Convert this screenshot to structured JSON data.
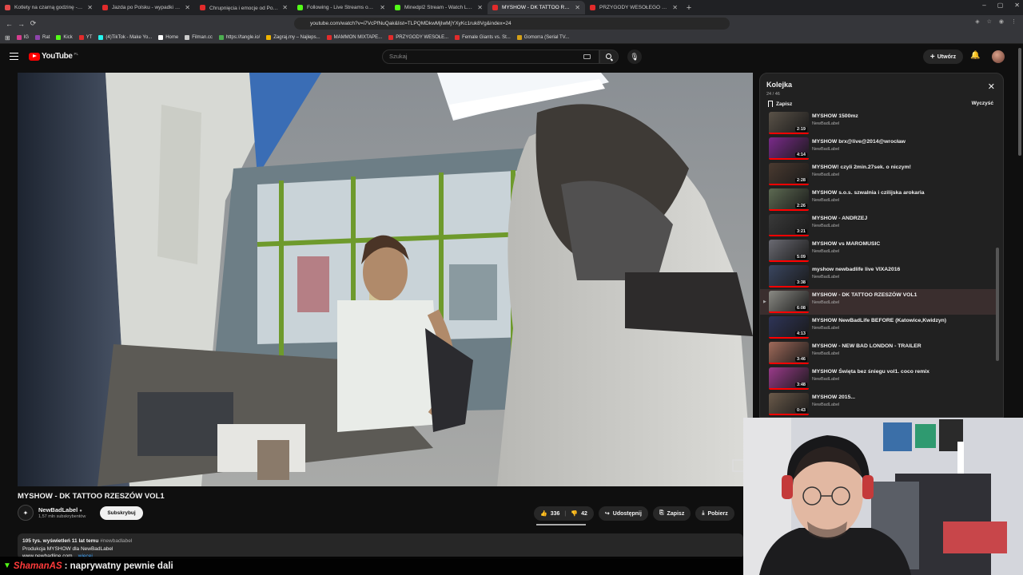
{
  "browser": {
    "tabs": [
      {
        "label": "Kotlety na czarną godzinę - mogą st",
        "fav": "#e24a4a"
      },
      {
        "label": "Jazda po Polsku - wypadki i kolizje o",
        "fav": "#e22b2b"
      },
      {
        "label": "Chrupnięcia i emocje od Poliny 😊",
        "fav": "#e22b2b"
      },
      {
        "label": "Following - Live Streams on Kick",
        "fav": "#53fc18"
      },
      {
        "label": "Minedpl2 Stream - Watch Live on Ki",
        "fav": "#53fc18"
      },
      {
        "label": "MYSHOW - DK TATTOO RZES",
        "fav": "#e22b2b",
        "active": true
      },
      {
        "label": "PRZYGODY WESOŁEGO MAZURA w",
        "fav": "#e22b2b"
      }
    ],
    "url": "youtube.com/watch?v=i7VcPfNuQak&list=TLPQMDkwMjIwMjYXyKc1ruk8Vg&index=24",
    "bookmarks": [
      {
        "label": "IG",
        "color": "#d63e8f"
      },
      {
        "label": "Rat",
        "color": "#8e44ad"
      },
      {
        "label": "Kick",
        "color": "#53fc18"
      },
      {
        "label": "YT",
        "color": "#e22b2b"
      },
      {
        "label": "(4)TikTok - Make Yo...",
        "color": "#25f4ee"
      },
      {
        "label": "Home",
        "color": "#ffffff"
      },
      {
        "label": "Filman.cc",
        "color": "#cccccc"
      },
      {
        "label": "https://tangle.io/",
        "color": "#4caf50"
      },
      {
        "label": "Zagraj.my – Najleps...",
        "color": "#f0b400"
      },
      {
        "label": "MAMMON MIXTAPE...",
        "color": "#e22b2b"
      },
      {
        "label": "PRZYGODY WESOŁE...",
        "color": "#e22b2b"
      },
      {
        "label": "Female Giants vs. St...",
        "color": "#e22b2b"
      },
      {
        "label": "Gomorra (Serial TV...",
        "color": "#d4a017"
      }
    ]
  },
  "youtube": {
    "logo_text": "YouTube",
    "logo_region": "PL",
    "search_placeholder": "Szukaj",
    "create_label": "Utwórz"
  },
  "video": {
    "title": "MYSHOW - DK TATTOO RZESZÓW VOL1",
    "channel_name": "NewBadLabel",
    "channel_subs": "1,57 mln subskrybentów",
    "subscribe_label": "Subskrybuj",
    "likes": "336",
    "dislikes": "42",
    "share_label": "Udostępnij",
    "save_label": "Zapisz",
    "download_label": "Pobierz",
    "desc_stats": "105 tys. wyświetleń  11 lat temu",
    "desc_hashtag": "#newbadlabel",
    "desc_text": "Produkcja MYSHOW dla NewBadLabel",
    "desc_link": "www.newbadline.com",
    "desc_more": "...więcej"
  },
  "queue": {
    "title": "Kolejka",
    "count": "24 / 46",
    "save_label": "Zapisz",
    "clear_label": "Wyczyść",
    "items": [
      {
        "title": "MYSHOW 1500mz",
        "channel": "NewBadLabel",
        "duration": "2:19",
        "color": "#5a5248"
      },
      {
        "title": "MYSHOW brx@live@2014@wrocław",
        "channel": "NewBadLabel",
        "duration": "4:14",
        "color": "#7a2a8a"
      },
      {
        "title": "MYSHOW! czyli 2min.27sek. o niczym!",
        "channel": "NewBadLabel",
        "duration": "2:28",
        "color": "#4a3a30"
      },
      {
        "title": "MYSHOW s.o.s. szwalnia i czilijska arokaria",
        "channel": "NewBadLabel",
        "duration": "2:26",
        "color": "#5d6a52"
      },
      {
        "title": "MYSHOW - ANDRZEJ",
        "channel": "NewBadLabel",
        "duration": "3:21",
        "color": "#3a3a3a"
      },
      {
        "title": "MYSHOW vs MAROMUSIC",
        "channel": "NewBadLabel",
        "duration": "5:09",
        "color": "#6a6a72"
      },
      {
        "title": "myshow newbadlife live VIXA2016",
        "channel": "NewBadLabel",
        "duration": "3:38",
        "color": "#3a4660"
      },
      {
        "title": "MYSHOW - DK TATTOO RZESZÓW VOL1",
        "channel": "NewBadLabel",
        "duration": "6:08",
        "color": "#8a8a84",
        "current": true
      },
      {
        "title": "MYSHOW NewBadLife BEFORE (Katowice,Kwidzyn)",
        "channel": "NewBadLabel",
        "duration": "4:13",
        "color": "#2e3458"
      },
      {
        "title": "MYSHOW - NEW BAD LONDON - TRAILER",
        "channel": "NewBadLabel",
        "duration": "3:46",
        "color": "#a06a5a"
      },
      {
        "title": "MYSHOW Święta bez śniegu vol1. coco remix",
        "channel": "NewBadLabel",
        "duration": "3:48",
        "color": "#9a3a8a"
      },
      {
        "title": "MYSHOW 2015...",
        "channel": "NewBadLabel",
        "duration": "0:43",
        "color": "#6a5a4a"
      }
    ]
  },
  "chat": {
    "username": "ShamanAS",
    "message": ": naprywatny pewnie dali"
  }
}
